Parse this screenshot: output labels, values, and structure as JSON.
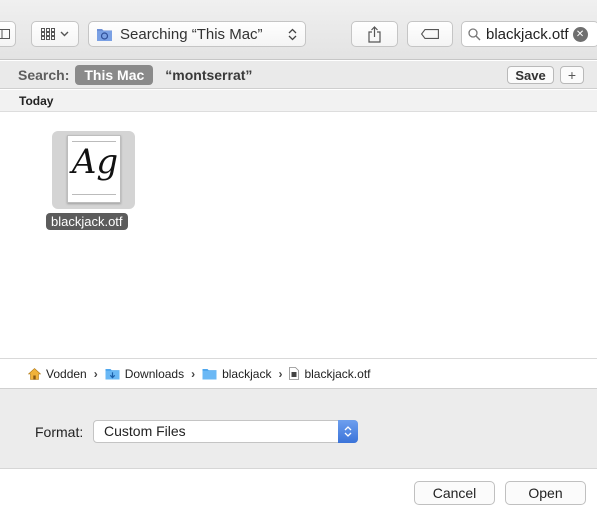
{
  "toolbar": {
    "location_label": "Searching “This Mac”",
    "search_value": "blackjack.otf"
  },
  "search_bar": {
    "label": "Search:",
    "scope_selected": "This Mac",
    "scope_other": "“montserrat”",
    "save_label": "Save",
    "add_label": "+"
  },
  "results": {
    "section_header": "Today",
    "files": [
      {
        "name": "blackjack.otf",
        "preview_text": "Ag",
        "icon": "font-file-icon"
      }
    ]
  },
  "path_bar": {
    "items": [
      {
        "label": "Vodden",
        "icon": "home-icon"
      },
      {
        "label": "Downloads",
        "icon": "downloads-folder-icon"
      },
      {
        "label": "blackjack",
        "icon": "folder-icon"
      },
      {
        "label": "blackjack.otf",
        "icon": "file-icon"
      }
    ]
  },
  "format": {
    "label": "Format:",
    "value": "Custom Files"
  },
  "buttons": {
    "cancel": "Cancel",
    "open": "Open"
  },
  "colors": {
    "accent": "#3b73d9",
    "folder_blue": "#5aaef2",
    "selection_gray": "#5c5c5c"
  }
}
